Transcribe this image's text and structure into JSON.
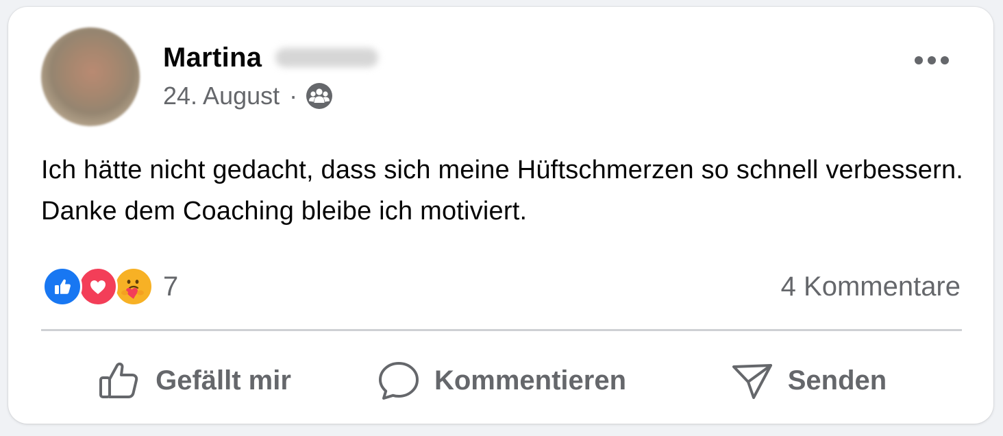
{
  "post": {
    "author_name": "Martina",
    "date": "24. August",
    "meta_separator": "·",
    "audience_icon": "friends-group-icon",
    "text": "Ich hätte nicht gedacht, dass sich meine Hüftschmerzen so schnell verbessern. Danke dem Coaching bleibe ich motiviert."
  },
  "reactions": {
    "types": [
      "like",
      "love",
      "care"
    ],
    "count": "7"
  },
  "comments": {
    "label": "4 Kommentare"
  },
  "actions": {
    "like_label": "Gefällt mir",
    "comment_label": "Kommentieren",
    "share_label": "Senden"
  },
  "colors": {
    "text": "#050505",
    "secondary": "#65676b",
    "like_blue": "#1877f2",
    "love_red": "#f33e58",
    "care_yellow": "#f7b125",
    "divider": "#ced0d4"
  }
}
